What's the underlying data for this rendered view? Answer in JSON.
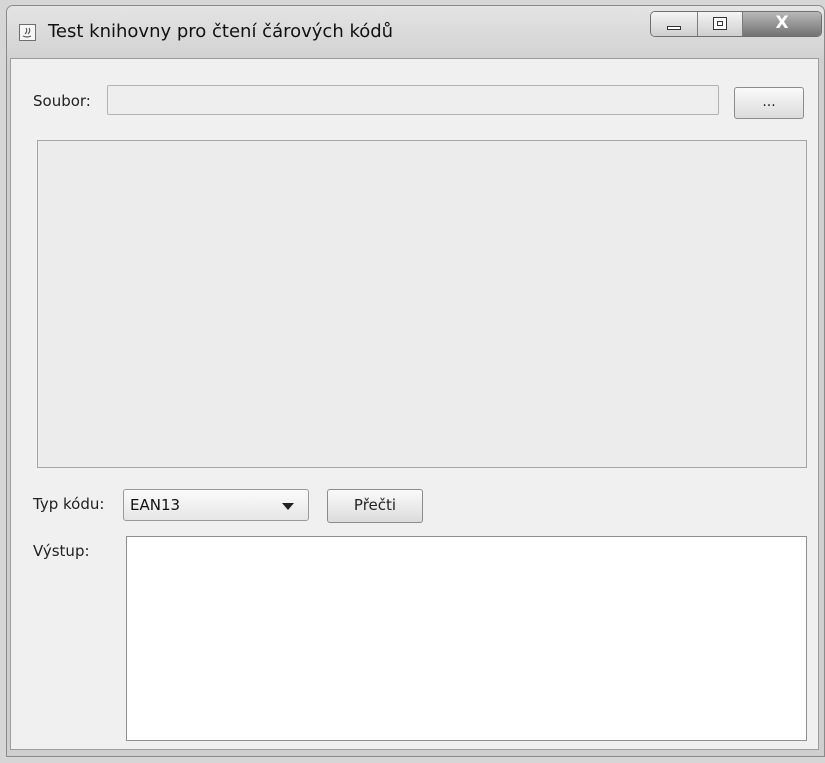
{
  "window": {
    "title": "Test knihovny pro čtení čárových kódů",
    "controls": {
      "close_glyph": "X"
    }
  },
  "file_row": {
    "label": "Soubor:",
    "value": "",
    "browse_label": "..."
  },
  "code_row": {
    "type_label": "Typ kódu:",
    "selected": "EAN13",
    "read_label": "Přečti"
  },
  "output": {
    "label": "Výstup:",
    "value": ""
  },
  "icons": [
    "java-app-icon",
    "minimize-icon",
    "maximize-icon",
    "close-icon",
    "chevron-down-icon"
  ]
}
